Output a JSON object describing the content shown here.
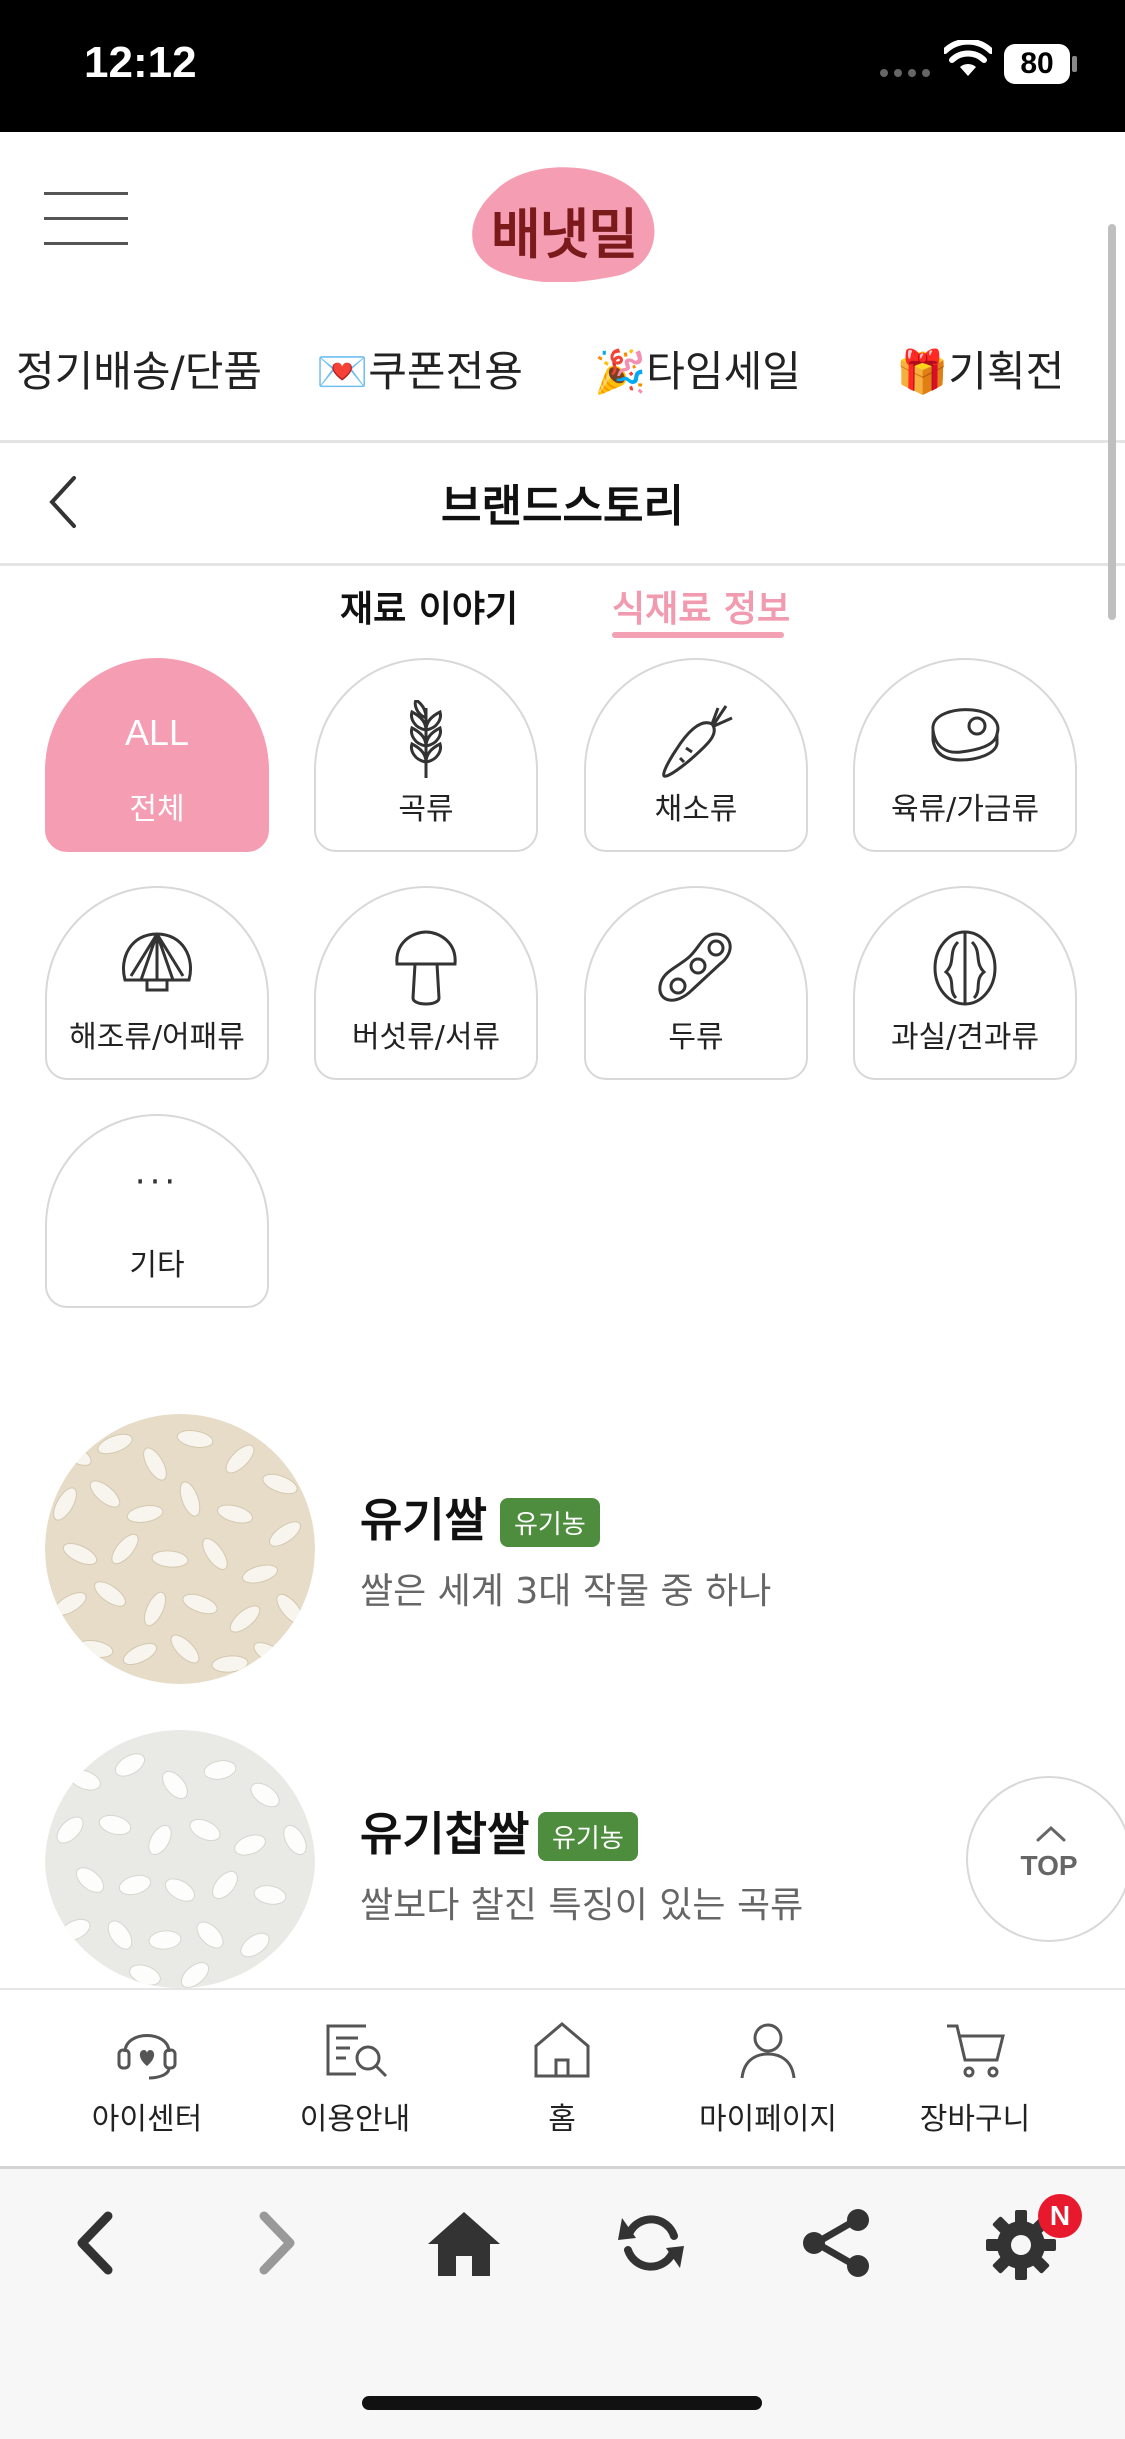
{
  "status_bar": {
    "time": "12:12",
    "battery": "80"
  },
  "header": {
    "logo_text": "배냇밀",
    "logo_color": "#f59db3"
  },
  "nav": {
    "items": [
      "정기배송/단품",
      "💌쿠폰전용",
      "🎉타임세일",
      "🎁기획전"
    ]
  },
  "page": {
    "title": "브랜드스토리"
  },
  "tabs": [
    {
      "label": "재료 이야기",
      "active": false
    },
    {
      "label": "식재료 정보",
      "active": true,
      "color": "#f29bb0"
    }
  ],
  "categories": [
    {
      "top": "ALL",
      "label": "전체",
      "icon": "all",
      "active": true
    },
    {
      "label": "곡류",
      "icon": "wheat-icon"
    },
    {
      "label": "채소류",
      "icon": "carrot-icon"
    },
    {
      "label": "육류/가금류",
      "icon": "meat-icon"
    },
    {
      "label": "해조류/어패류",
      "icon": "shell-icon"
    },
    {
      "label": "버섯류/서류",
      "icon": "mushroom-icon"
    },
    {
      "label": "두류",
      "icon": "bean-icon"
    },
    {
      "label": "과실/견과류",
      "icon": "walnut-icon"
    },
    {
      "top": "···",
      "label": "기타",
      "icon": "more-icon"
    }
  ],
  "items": [
    {
      "name": "유기쌀",
      "badge": "유기농",
      "desc": "쌀은 세계 3대 작물 중 하나"
    },
    {
      "name": "유기찹쌀",
      "badge": "유기농",
      "desc": "쌀보다 찰진 특징이 있는 곡류"
    }
  ],
  "top_button": {
    "label": "TOP"
  },
  "bottom_menu": [
    {
      "label": "아이센터",
      "icon": "headset-icon"
    },
    {
      "label": "이용안내",
      "icon": "guide-icon"
    },
    {
      "label": "홈",
      "icon": "house-icon"
    },
    {
      "label": "마이페이지",
      "icon": "person-icon"
    },
    {
      "label": "장바구니",
      "icon": "cart-icon"
    }
  ],
  "browser_bar": {
    "notification_badge": "N"
  }
}
